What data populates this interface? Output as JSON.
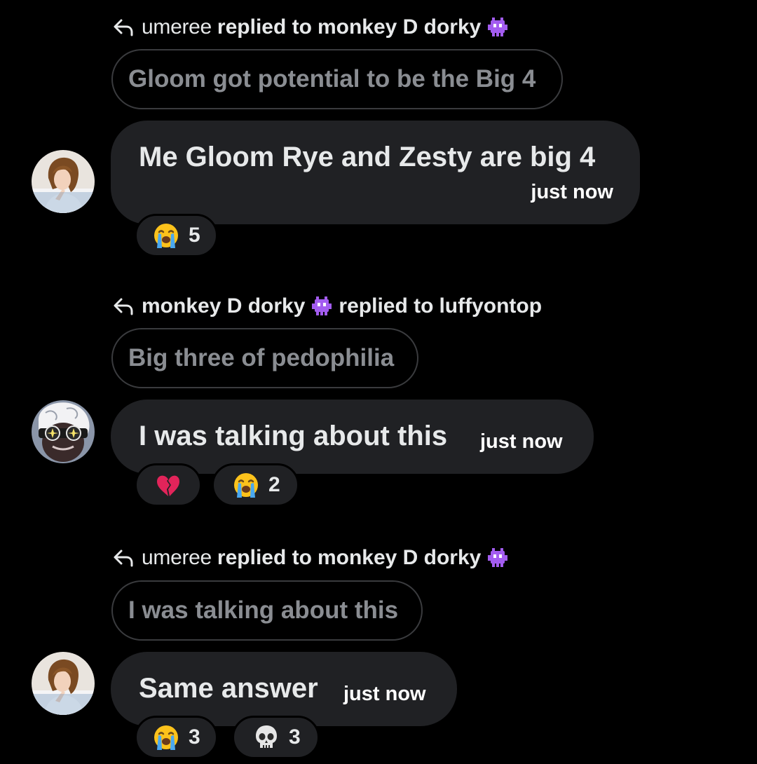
{
  "messages": [
    {
      "reply_user": "umeree",
      "reply_verb": "replied to",
      "reply_target": "monkey D dorky",
      "reply_target_badge": "alien-monster-icon",
      "quoted_text": "Gloom got potential to be the Big 4",
      "avatar": "avatar-girl-icon",
      "text": "Me Gloom Rye and Zesty are big 4",
      "time": "just now",
      "reactions": [
        {
          "emoji": "loudly-crying-face-icon",
          "count": "5"
        }
      ]
    },
    {
      "reply_user": "monkey D dorky",
      "reply_user_badge": "alien-monster-icon",
      "reply_verb": "replied to",
      "reply_target": "luffyontop",
      "quoted_text": "Big three of pedophilia",
      "avatar": "avatar-sunglasses-icon",
      "text": "I was talking about this",
      "time": "just now",
      "reactions": [
        {
          "emoji": "broken-heart-icon",
          "count": ""
        },
        {
          "emoji": "loudly-crying-face-icon",
          "count": "2"
        }
      ]
    },
    {
      "reply_user": "umeree",
      "reply_verb": "replied to",
      "reply_target": "monkey D dorky",
      "reply_target_badge": "alien-monster-icon",
      "quoted_text": "I was talking about this",
      "avatar": "avatar-girl-icon",
      "text": "Same answer",
      "time": "just now",
      "reactions": [
        {
          "emoji": "loudly-crying-face-icon",
          "count": "3"
        },
        {
          "emoji": "skull-icon",
          "count": "3"
        }
      ]
    }
  ],
  "colors": {
    "background": "#000000",
    "bubble": "#202124",
    "quote_border": "#3a3b3e",
    "quote_text": "#8a8d92",
    "text": "#e7e9ea",
    "badge": "#a35cf0"
  }
}
